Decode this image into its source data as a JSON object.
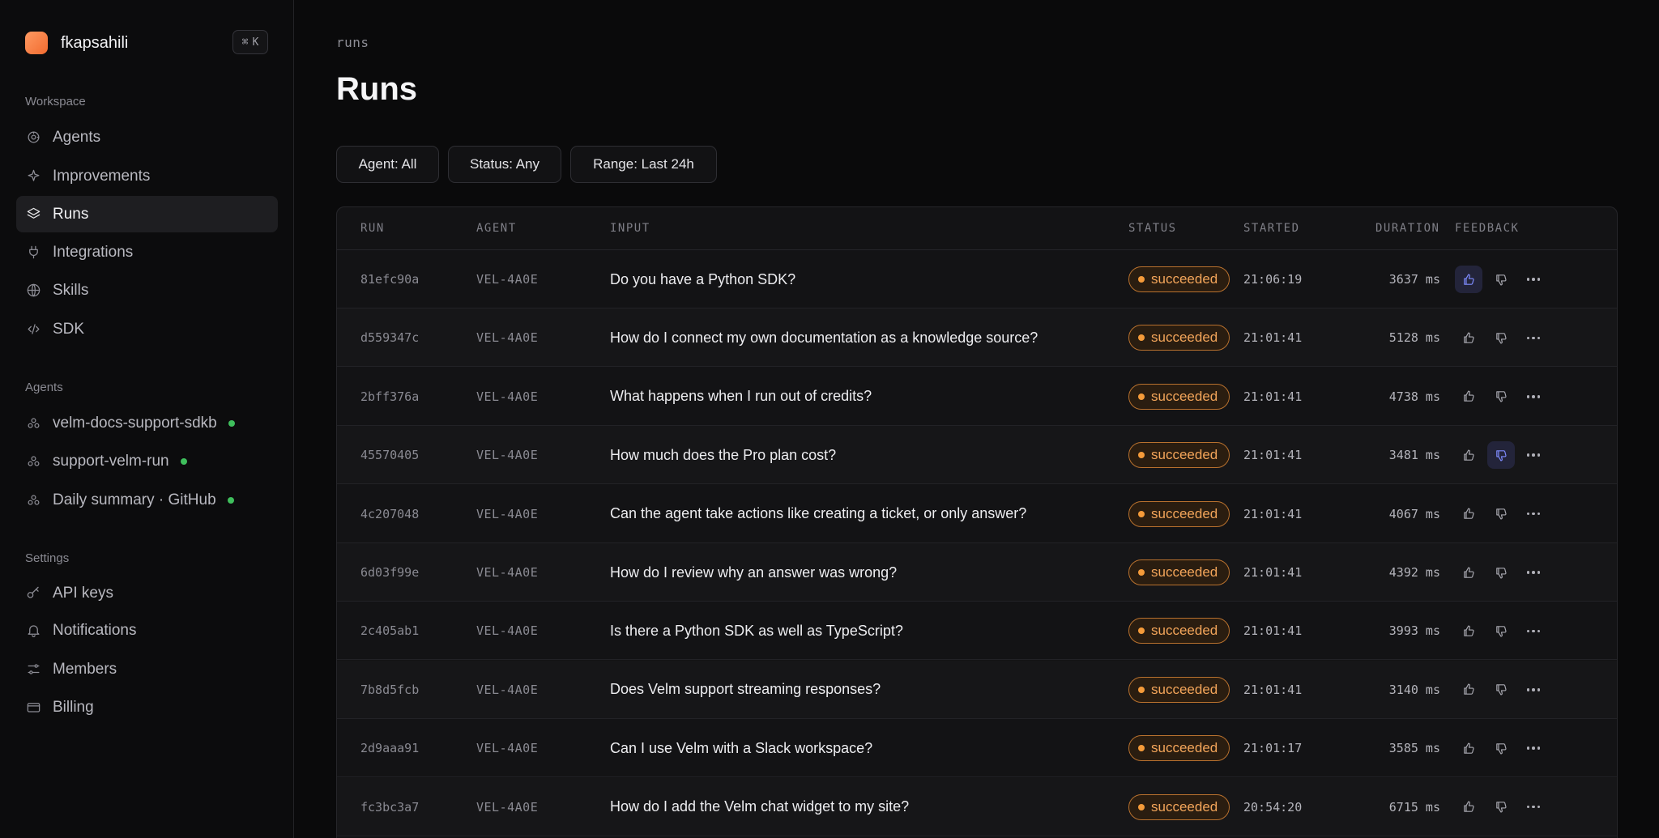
{
  "workspace": {
    "name": "fkapsahili",
    "shortcut_symbol": "⌘",
    "shortcut_key": "K"
  },
  "sidebar": {
    "workspace_label": "Workspace",
    "workspace_items": [
      {
        "label": "Agents",
        "icon": "agents-icon",
        "active": false
      },
      {
        "label": "Improvements",
        "icon": "sparkle-icon",
        "active": false
      },
      {
        "label": "Runs",
        "icon": "layers-icon",
        "active": true
      },
      {
        "label": "Integrations",
        "icon": "plug-icon",
        "active": false
      },
      {
        "label": "Skills",
        "icon": "globe-icon",
        "active": false
      },
      {
        "label": "SDK",
        "icon": "code-icon",
        "active": false
      }
    ],
    "agents_label": "Agents",
    "agent_items": [
      {
        "label": "velm-docs-support-sdkb",
        "status": "online"
      },
      {
        "label": "support-velm-run",
        "status": "online"
      },
      {
        "label": "Daily summary · GitHub",
        "status": "online"
      }
    ],
    "settings_label": "Settings",
    "settings_items": [
      {
        "label": "API keys",
        "icon": "key-icon"
      },
      {
        "label": "Notifications",
        "icon": "bell-icon"
      },
      {
        "label": "Members",
        "icon": "sliders-icon"
      },
      {
        "label": "Billing",
        "icon": "card-icon"
      }
    ]
  },
  "page": {
    "breadcrumb": "runs",
    "title": "Runs"
  },
  "filters": {
    "agent": "Agent: All",
    "status": "Status: Any",
    "range": "Range: Last 24h"
  },
  "table": {
    "columns": [
      "RUN",
      "AGENT",
      "INPUT",
      "STATUS",
      "STARTED",
      "DURATION",
      "FEEDBACK"
    ],
    "rows": [
      {
        "run": "81efc90a",
        "agent": "VEL-4A0E",
        "input": "Do you have a Python SDK?",
        "status": "succeeded",
        "started": "21:06:19",
        "duration": "3637 ms",
        "feedback": "up"
      },
      {
        "run": "d559347c",
        "agent": "VEL-4A0E",
        "input": "How do I connect my own documentation as a knowledge source?",
        "status": "succeeded",
        "started": "21:01:41",
        "duration": "5128 ms",
        "feedback": "none"
      },
      {
        "run": "2bff376a",
        "agent": "VEL-4A0E",
        "input": "What happens when I run out of credits?",
        "status": "succeeded",
        "started": "21:01:41",
        "duration": "4738 ms",
        "feedback": "none"
      },
      {
        "run": "45570405",
        "agent": "VEL-4A0E",
        "input": "How much does the Pro plan cost?",
        "status": "succeeded",
        "started": "21:01:41",
        "duration": "3481 ms",
        "feedback": "down"
      },
      {
        "run": "4c207048",
        "agent": "VEL-4A0E",
        "input": "Can the agent take actions like creating a ticket, or only answer?",
        "status": "succeeded",
        "started": "21:01:41",
        "duration": "4067 ms",
        "feedback": "none"
      },
      {
        "run": "6d03f99e",
        "agent": "VEL-4A0E",
        "input": "How do I review why an answer was wrong?",
        "status": "succeeded",
        "started": "21:01:41",
        "duration": "4392 ms",
        "feedback": "none"
      },
      {
        "run": "2c405ab1",
        "agent": "VEL-4A0E",
        "input": "Is there a Python SDK as well as TypeScript?",
        "status": "succeeded",
        "started": "21:01:41",
        "duration": "3993 ms",
        "feedback": "none"
      },
      {
        "run": "7b8d5fcb",
        "agent": "VEL-4A0E",
        "input": "Does Velm support streaming responses?",
        "status": "succeeded",
        "started": "21:01:41",
        "duration": "3140 ms",
        "feedback": "none"
      },
      {
        "run": "2d9aaa91",
        "agent": "VEL-4A0E",
        "input": "Can I use Velm with a Slack workspace?",
        "status": "succeeded",
        "started": "21:01:17",
        "duration": "3585 ms",
        "feedback": "none"
      },
      {
        "run": "fc3bc3a7",
        "agent": "VEL-4A0E",
        "input": "How do I add the Velm chat widget to my site?",
        "status": "succeeded",
        "started": "20:54:20",
        "duration": "6715 ms",
        "feedback": "none"
      }
    ]
  },
  "colors": {
    "accent": "#7f8cff",
    "status_succeeded": "#f3a55a",
    "online": "#3fbf5c",
    "brand": "#f26b2f"
  }
}
